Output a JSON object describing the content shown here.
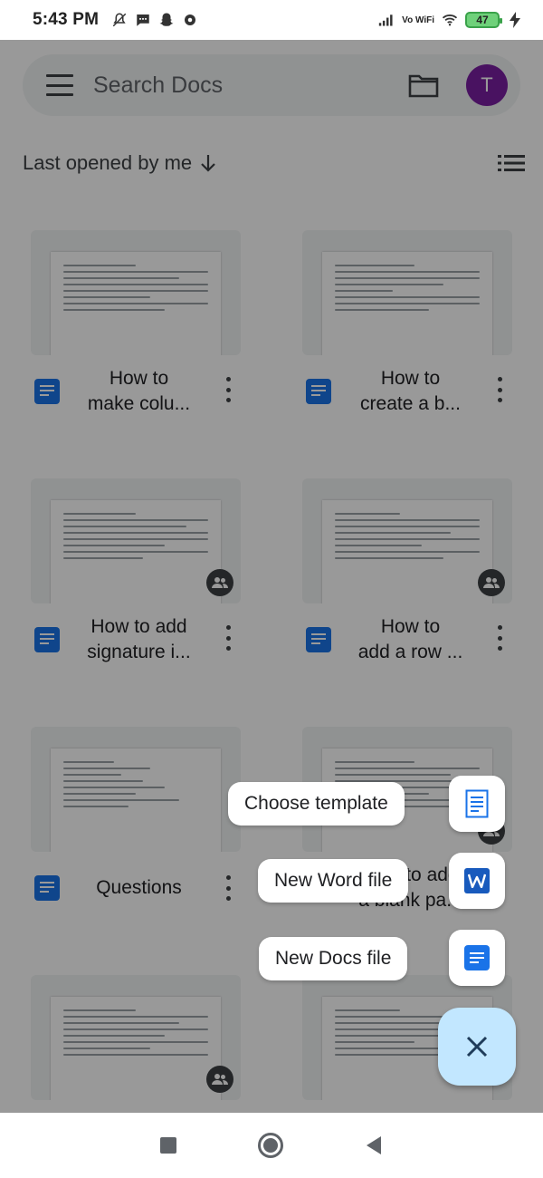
{
  "status_bar": {
    "time": "5:43 PM",
    "battery": "47",
    "network": "Vo WiFi"
  },
  "search": {
    "placeholder": "Search Docs",
    "avatar_initial": "T"
  },
  "sort": {
    "label": "Last opened by me"
  },
  "documents": [
    {
      "title_line1": "How to",
      "title_line2": "make colu...",
      "shared": false
    },
    {
      "title_line1": "How to",
      "title_line2": "create a b...",
      "shared": false
    },
    {
      "title_line1": "How to add",
      "title_line2": "signature i...",
      "shared": true
    },
    {
      "title_line1": "How to",
      "title_line2": "add a row ...",
      "shared": true
    },
    {
      "title_line1": "Questions",
      "title_line2": "",
      "shared": false
    },
    {
      "title_line1": "How to add",
      "title_line2": "a blank pa...",
      "shared": true
    },
    {
      "title_line1": "",
      "title_line2": "",
      "shared": true
    },
    {
      "title_line1": "",
      "title_line2": "",
      "shared": false
    }
  ],
  "fab_menu": {
    "choose_template": "Choose template",
    "new_word_file": "New Word file",
    "new_docs_file": "New Docs file"
  },
  "colors": {
    "docs_blue": "#1a73e8",
    "avatar": "#7b1fa2",
    "fab": "#c2e7ff",
    "word_blue": "#185abd"
  }
}
